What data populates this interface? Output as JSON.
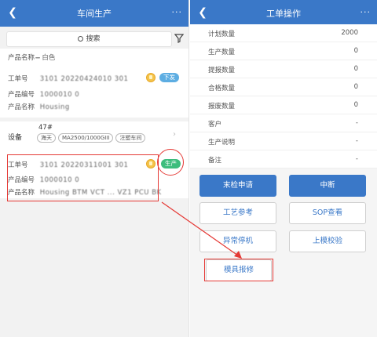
{
  "left": {
    "header": {
      "back_icon": "chevron-left-icon",
      "title": "车间生产",
      "more": "···"
    },
    "search": {
      "label": "搜索",
      "icon": "search-icon",
      "filter_icon": "filter-icon"
    },
    "item1": {
      "product_name_label": "产品名称",
      "product_name_value": "̶̶ 白色",
      "order_no_label": "工单号",
      "order_no_value": "3101 20220424010 301",
      "product_code_label": "产品编号",
      "product_code_value": "1000010 0",
      "product_name2_label": "产品名称",
      "product_name2_value": "Housing",
      "status": "下发"
    },
    "device": {
      "label": "设备",
      "number": "47#",
      "tags": [
        "海天",
        "MA2500/1000GIII",
        "注塑车间"
      ]
    },
    "item2": {
      "order_no_label": "工单号",
      "order_no_value": "3101 20220311001 301",
      "product_code_label": "产品编号",
      "product_code_value": "1000010 0",
      "product_name_label": "产品名称",
      "product_name_value": "Housing BTM  VCT ...  VZ1 PCU BK",
      "status": "生产"
    }
  },
  "right": {
    "header": {
      "back_icon": "chevron-left-icon",
      "title": "工单操作",
      "more": "···"
    },
    "fields": [
      {
        "label": "计划数量",
        "value": "2000"
      },
      {
        "label": "生产数量",
        "value": "0"
      },
      {
        "label": "提报数量",
        "value": "0"
      },
      {
        "label": "合格数量",
        "value": "0"
      },
      {
        "label": "报废数量",
        "value": "0"
      },
      {
        "label": "客户",
        "value": "-"
      },
      {
        "label": "生产说明",
        "value": "-"
      },
      {
        "label": "备注",
        "value": "-"
      }
    ],
    "buttons": {
      "inspect": "末检申请",
      "interrupt": "中断",
      "process_ref": "工艺参考",
      "sop": "SOP查看",
      "abnormal_stop": "异常停机",
      "mold_check": "上模校验",
      "mold_repair": "模具报修"
    }
  },
  "colors": {
    "brand": "#3a78c8",
    "annotation": "#e53935",
    "badge_blue": "#5dade2",
    "badge_green": "#3dbd7d",
    "medal": "#f4c34a"
  }
}
